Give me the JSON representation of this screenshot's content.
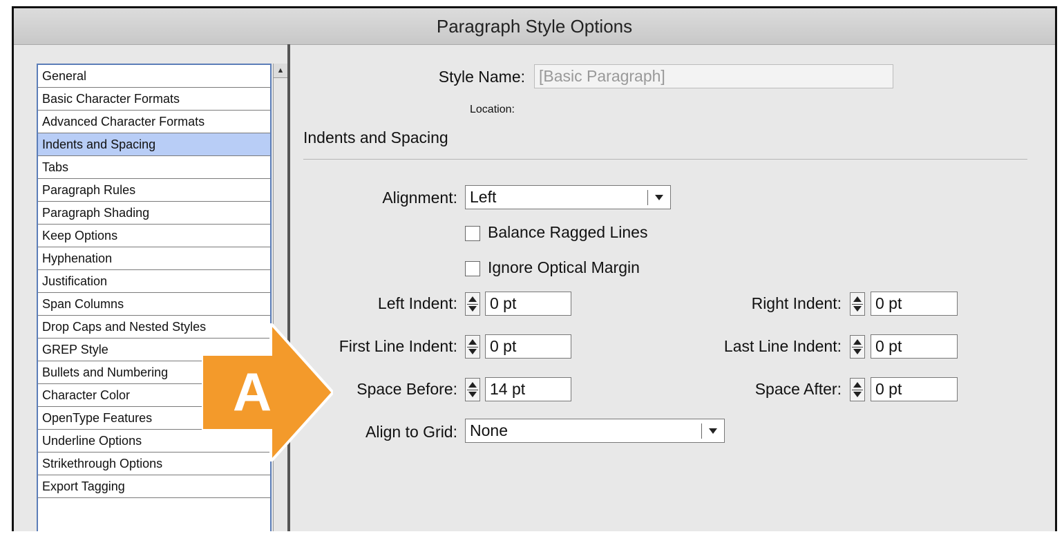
{
  "window": {
    "title": "Paragraph Style Options"
  },
  "sidebar": {
    "items": [
      {
        "label": "General",
        "selected": false
      },
      {
        "label": "Basic Character Formats",
        "selected": false
      },
      {
        "label": "Advanced Character Formats",
        "selected": false
      },
      {
        "label": "Indents and Spacing",
        "selected": true
      },
      {
        "label": "Tabs",
        "selected": false
      },
      {
        "label": "Paragraph Rules",
        "selected": false
      },
      {
        "label": "Paragraph Shading",
        "selected": false
      },
      {
        "label": "Keep Options",
        "selected": false
      },
      {
        "label": "Hyphenation",
        "selected": false
      },
      {
        "label": "Justification",
        "selected": false
      },
      {
        "label": "Span Columns",
        "selected": false
      },
      {
        "label": "Drop Caps and Nested Styles",
        "selected": false
      },
      {
        "label": "GREP Style",
        "selected": false
      },
      {
        "label": "Bullets and Numbering",
        "selected": false
      },
      {
        "label": "Character Color",
        "selected": false
      },
      {
        "label": "OpenType Features",
        "selected": false
      },
      {
        "label": "Underline Options",
        "selected": false
      },
      {
        "label": "Strikethrough Options",
        "selected": false
      },
      {
        "label": "Export Tagging",
        "selected": false
      }
    ]
  },
  "form": {
    "style_name_label": "Style Name:",
    "style_name_value": "[Basic Paragraph]",
    "location_label": "Location:",
    "section_title": "Indents and Spacing",
    "alignment_label": "Alignment:",
    "alignment_value": "Left",
    "balance_ragged_label": "Balance Ragged Lines",
    "balance_ragged_checked": false,
    "ignore_optical_label": "Ignore Optical Margin",
    "ignore_optical_checked": false,
    "left_indent_label": "Left Indent:",
    "left_indent_value": "0 pt",
    "right_indent_label": "Right Indent:",
    "right_indent_value": "0 pt",
    "first_line_indent_label": "First Line Indent:",
    "first_line_indent_value": "0 pt",
    "last_line_indent_label": "Last Line Indent:",
    "last_line_indent_value": "0 pt",
    "space_before_label": "Space Before:",
    "space_before_value": "14 pt",
    "space_after_label": "Space After:",
    "space_after_value": "0 pt",
    "align_to_grid_label": "Align to Grid:",
    "align_to_grid_value": "None"
  },
  "callout": {
    "letter": "A",
    "color": "#f39a2b"
  },
  "colors": {
    "selection": "#b8cdf6",
    "list_border": "#5b7db8"
  }
}
